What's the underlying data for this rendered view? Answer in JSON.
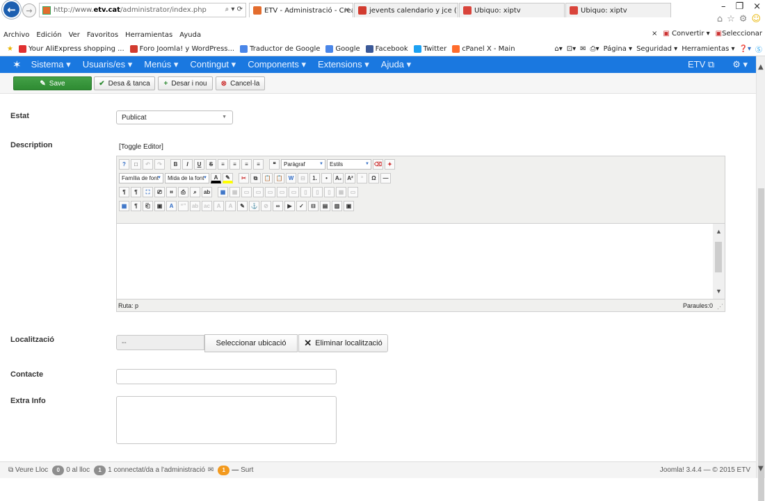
{
  "browser": {
    "address": {
      "scheme": "http://www.",
      "host": "etv.cat",
      "path": "/administrator/index.php",
      "tools": "⌕ ▾ ⟳"
    },
    "tabs": [
      {
        "label": "ETV - Administració - Creat...",
        "close": "×"
      },
      {
        "label": "jevents calendario y jce (1/1)"
      },
      {
        "label": "Ubiquo: xiptv"
      },
      {
        "label": "Ubiquo: xiptv"
      }
    ],
    "menu": [
      "Archivo",
      "Edición",
      "Ver",
      "Favoritos",
      "Herramientas",
      "Ayuda"
    ],
    "menu_right": {
      "close": "×",
      "convert": "Convertir ▾",
      "select": "Seleccionar"
    },
    "favorites": [
      {
        "label": "Your AliExpress shopping ...",
        "color": "#e03030"
      },
      {
        "label": "Foro Joomla! y WordPress...",
        "color": "#d23b2f"
      },
      {
        "label": "Traductor de Google",
        "color": "#4a86e8"
      },
      {
        "label": "Google",
        "color": "#4a86e8"
      },
      {
        "label": "Facebook",
        "color": "#3b5998"
      },
      {
        "label": "Twitter",
        "color": "#1da1f2"
      },
      {
        "label": "cPanel X - Main",
        "color": "#ff6c2c"
      }
    ],
    "fav_right": {
      "page": "Página ▾",
      "security": "Seguridad ▾",
      "tools": "Herramientas ▾"
    }
  },
  "admin": {
    "nav": [
      "Sistema ▾",
      "Usuaris/es ▾",
      "Menús ▾",
      "Contingut ▾",
      "Components ▾",
      "Extensions ▾",
      "Ajuda ▾"
    ],
    "nav_right": {
      "site": "ETV ⧉",
      "settings": "⚙ ▾"
    },
    "toolbar": {
      "save": "Save",
      "save_close": "Desa & tanca",
      "save_new": "Desar i nou",
      "cancel": "Cancel·la"
    }
  },
  "form": {
    "estat_label": "Estat",
    "estat_value": "Publicat",
    "description_label": "Description",
    "toggle_editor": "[Toggle Editor]",
    "editor": {
      "paragraph_select": "Paràgraf",
      "styles_select": "Estils",
      "font_family": "Família de font",
      "font_size": "Mida de la font",
      "path": "Ruta: p",
      "words": "Paraules:0"
    },
    "localitzacio_label": "Localització",
    "localitzacio_value": "--",
    "select_location": "Seleccionar ubicació",
    "remove_location": "Eliminar localització",
    "contacte_label": "Contacte",
    "extra_info_label": "Extra Info"
  },
  "status": {
    "view_site": "Veure Lloc",
    "visitors_count": "0",
    "visitors_label": "al lloc",
    "admins_count": "1",
    "admins_label": "connectat/da a l'administració",
    "messages_count": "1",
    "logout": "Surt",
    "version": "Joomla! 3.4.4 — © 2015 ETV"
  }
}
